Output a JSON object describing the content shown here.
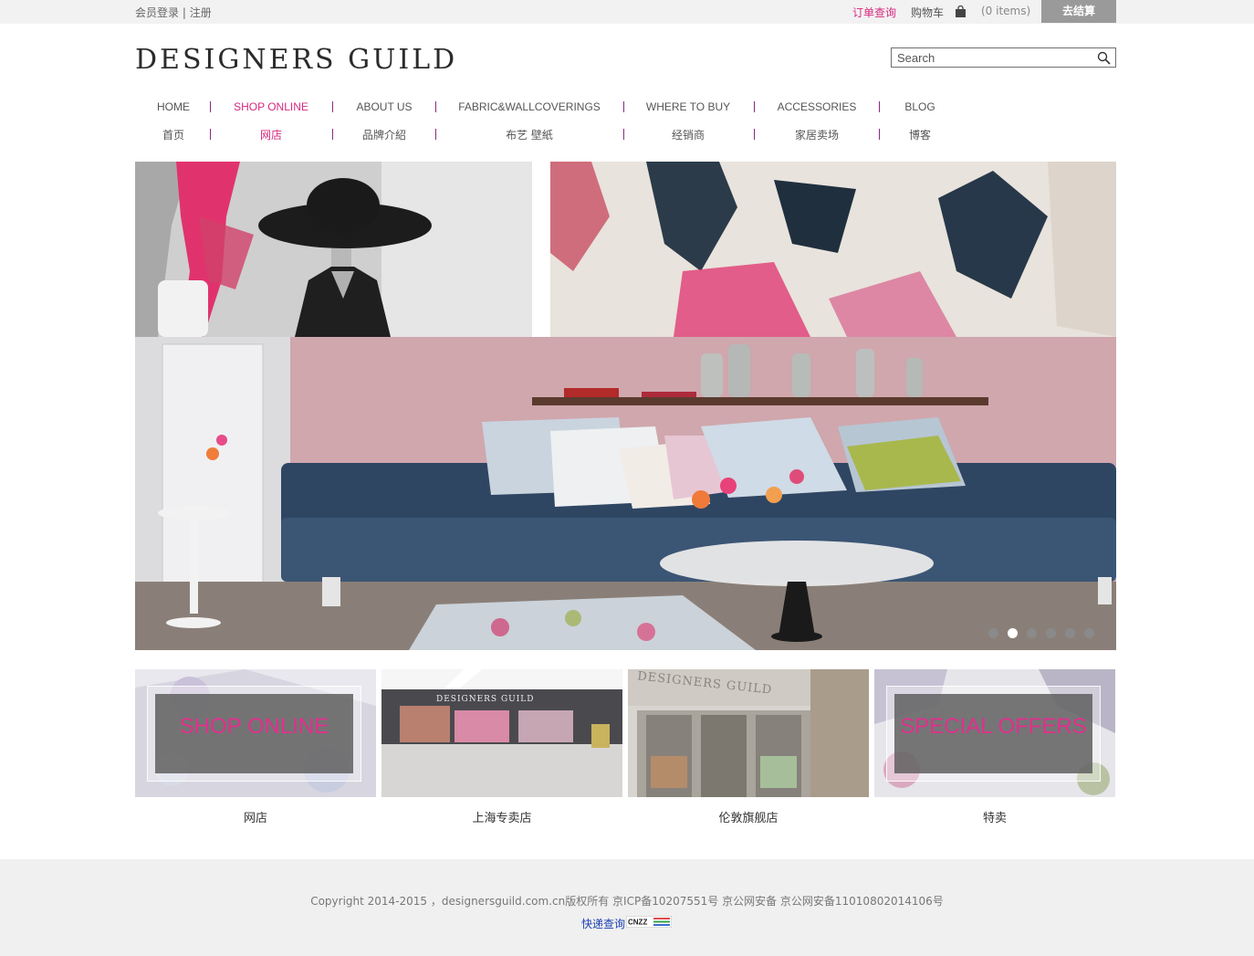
{
  "topbar": {
    "login": "会员登录",
    "divider": " | ",
    "register": "注册",
    "order_lookup": "订单查询",
    "cart": "购物车",
    "items": "(0 items)",
    "checkout": "去结算"
  },
  "header": {
    "logo": "DESIGNERS GUILD",
    "search_placeholder": "Search"
  },
  "nav": {
    "items": [
      {
        "en": "HOME",
        "zh": "首页"
      },
      {
        "en": "SHOP ONLINE",
        "zh": "网店"
      },
      {
        "en": "ABOUT US",
        "zh": "品牌介紹"
      },
      {
        "en": "FABRIC&WALLCOVERINGS",
        "zh": "布艺 壁紙"
      },
      {
        "en": "WHERE TO BUY",
        "zh": "经销商"
      },
      {
        "en": "ACCESSORIES",
        "zh": "家居卖场"
      },
      {
        "en": "BLOG",
        "zh": "博客"
      }
    ],
    "active_index": 1
  },
  "hero": {
    "slide_count": 6,
    "active_slide": 1
  },
  "tiles": [
    {
      "caption": "网店",
      "overlay": "SHOP ONLINE"
    },
    {
      "caption": "上海专卖店",
      "sign": "DESIGNERS GUILD"
    },
    {
      "caption": "伦敦旗舰店",
      "sign": "DESIGNERS GUILD"
    },
    {
      "caption": "特卖",
      "overlay": "SPECIAL OFFERS"
    }
  ],
  "footer": {
    "copyright": "Copyright 2014-2015 ，designersguild.com.cn版权所有 京ICP备10207551号 京公网安备 京公网安备11010802014106号",
    "express": "快递查询",
    "badge": "CNZZ"
  },
  "colors": {
    "accent": "#d6297f",
    "nav_separator": "#8a2a82",
    "checkout_bg": "#9a9a9a",
    "footer_bg": "#f0f0f0",
    "topbar_bg": "#f2f2f2"
  }
}
